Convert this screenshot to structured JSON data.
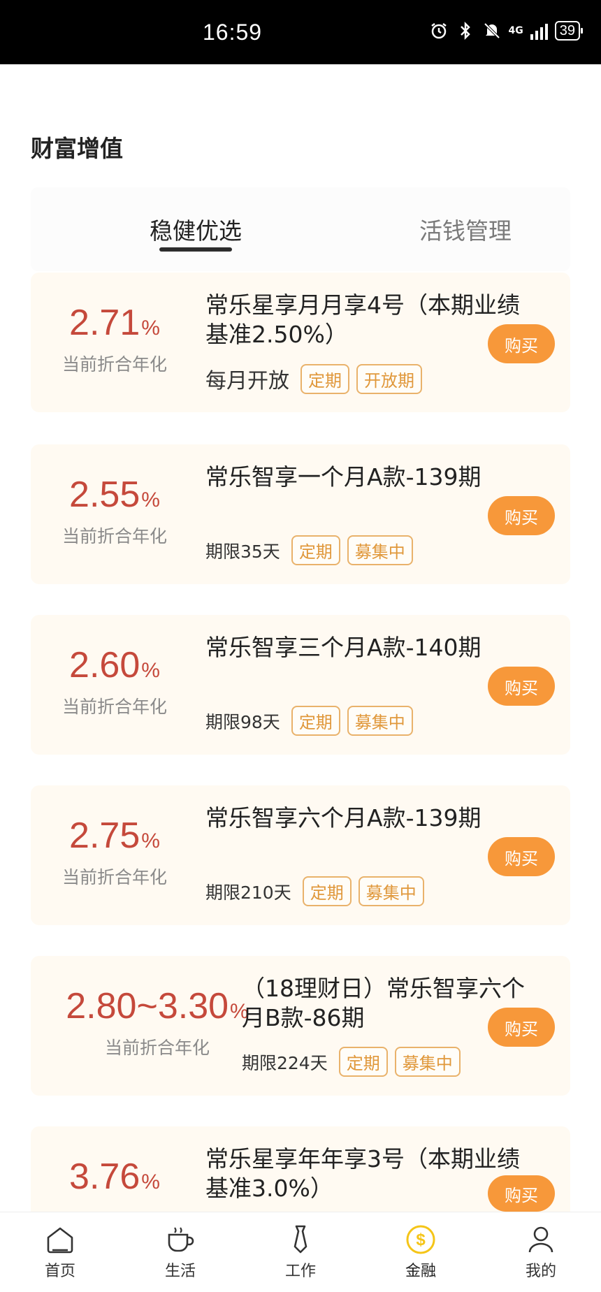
{
  "status_bar": {
    "time": "16:59",
    "network": "4G",
    "battery": "39",
    "icons": [
      "alarm-icon",
      "bluetooth-icon",
      "mute-icon",
      "signal-icon",
      "battery-icon"
    ]
  },
  "section_title": "财富增值",
  "tabs": [
    {
      "label": "稳健优选",
      "active": true
    },
    {
      "label": "活钱管理",
      "active": false
    }
  ],
  "products": [
    {
      "rate": "2.71",
      "pct": "%",
      "rate_label": "当前折合年化",
      "name": "常乐星享月月享4号（本期业绩基准2.50%）",
      "meta": "每月开放",
      "tags": [
        "定期",
        "开放期"
      ],
      "buy": "购买"
    },
    {
      "rate": "2.55",
      "pct": "%",
      "rate_label": "当前折合年化",
      "name": "常乐智享一个月A款-139期",
      "meta": "期限35天",
      "tags": [
        "定期",
        "募集中"
      ],
      "buy": "购买"
    },
    {
      "rate": "2.60",
      "pct": "%",
      "rate_label": "当前折合年化",
      "name": "常乐智享三个月A款-140期",
      "meta": "期限98天",
      "tags": [
        "定期",
        "募集中"
      ],
      "buy": "购买"
    },
    {
      "rate": "2.75",
      "pct": "%",
      "rate_label": "当前折合年化",
      "name": "常乐智享六个月A款-139期",
      "meta": "期限210天",
      "tags": [
        "定期",
        "募集中"
      ],
      "buy": "购买"
    },
    {
      "rate": "2.80~3.30",
      "pct": "%",
      "rate_label": "当前折合年化",
      "name": "（18理财日）常乐智享六个月B款-86期",
      "meta": "期限224天",
      "tags": [
        "定期",
        "募集中"
      ],
      "buy": "购买"
    },
    {
      "rate": "3.76",
      "pct": "%",
      "rate_label": "",
      "name": "常乐星享年年享3号（本期业绩基准3.0%）",
      "meta": "",
      "tags": [],
      "buy": "购买"
    }
  ],
  "bottom_nav": [
    {
      "label": "首页",
      "icon": "home-icon",
      "active": false
    },
    {
      "label": "生活",
      "icon": "coffee-cup-icon",
      "active": false
    },
    {
      "label": "工作",
      "icon": "tie-icon",
      "active": false
    },
    {
      "label": "金融",
      "icon": "dollar-coin-icon",
      "active": true
    },
    {
      "label": "我的",
      "icon": "user-icon",
      "active": false
    }
  ],
  "colors": {
    "rate": "#c5493b",
    "buy_button": "#f7983a",
    "tag_border": "#e9b26b",
    "card_bg": "#fffaf2",
    "active_nav_icon": "#f5c518"
  }
}
